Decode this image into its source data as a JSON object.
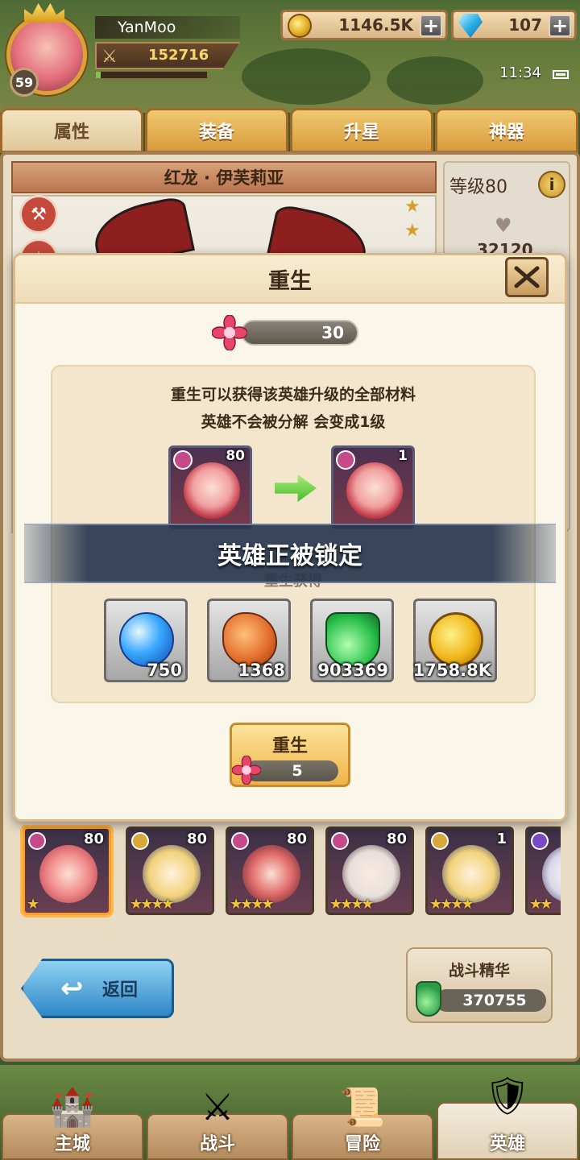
{
  "player": {
    "name": "YanMoo",
    "level": "59",
    "power": "152716",
    "exp_fraction": 0.04
  },
  "currency": {
    "gold": "1146.5K",
    "gems": "107"
  },
  "status": {
    "time": "11:34"
  },
  "tabs": [
    {
      "label": "属性",
      "active": true
    },
    {
      "label": "装备",
      "active": false
    },
    {
      "label": "升星",
      "active": false
    },
    {
      "label": "神器",
      "active": false
    }
  ],
  "hero": {
    "name": "红龙 · 伊芙莉亚",
    "level_text": "等级80",
    "hp": "32120"
  },
  "modal": {
    "title": "重生",
    "cost_have": "30",
    "desc_line1": "重生可以获得该英雄升级的全部材料",
    "desc_line2": "英雄不会被分解 会变成1级",
    "level_before": "80",
    "level_after": "1",
    "lock_message": "英雄正被锁定",
    "reward_label": "重生获得",
    "rewards": [
      {
        "icon": "blue-orb-icon",
        "value": "750"
      },
      {
        "icon": "rune-stone-icon",
        "value": "1368"
      },
      {
        "icon": "green-potion-icon",
        "value": "903369"
      },
      {
        "icon": "gold-coin-icon",
        "value": "1758.8K"
      }
    ],
    "button_label": "重生",
    "button_cost": "5"
  },
  "hero_list": [
    {
      "level": "80",
      "stars": "★",
      "element_color": "#c64a8a"
    },
    {
      "level": "80",
      "stars": "★★★★",
      "element_color": "#d8a83a"
    },
    {
      "level": "80",
      "stars": "★★★★",
      "element_color": "#c64a8a"
    },
    {
      "level": "80",
      "stars": "★★★★",
      "element_color": "#c64a8a"
    },
    {
      "level": "1",
      "stars": "★★★★",
      "element_color": "#d8a83a"
    },
    {
      "level": "",
      "stars": "★★",
      "element_color": "#7a4ac6"
    }
  ],
  "footer": {
    "back_label": "返回",
    "essence_title": "战斗精华",
    "essence_value": "370755"
  },
  "nav": [
    {
      "label": "主城",
      "icon": "castle-icon",
      "active": false
    },
    {
      "label": "战斗",
      "icon": "crossed-swords-icon",
      "active": false
    },
    {
      "label": "冒险",
      "icon": "scroll-map-icon",
      "active": false
    },
    {
      "label": "英雄",
      "icon": "hero-helmet-icon",
      "active": true
    }
  ],
  "colors": {
    "accent_gold": "#f0b44a",
    "panel_bg": "#fbf6ea",
    "lock_banner": "#28374f"
  }
}
